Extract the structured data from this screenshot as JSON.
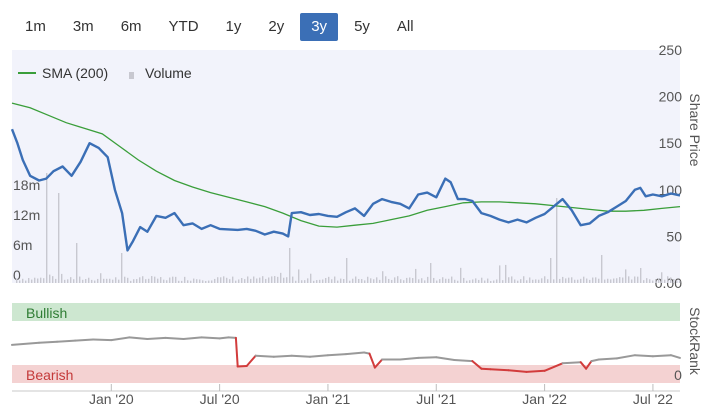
{
  "range_selector": {
    "buttons": [
      {
        "label": "1m",
        "active": false
      },
      {
        "label": "3m",
        "active": false
      },
      {
        "label": "6m",
        "active": false
      },
      {
        "label": "YTD",
        "active": false
      },
      {
        "label": "1y",
        "active": false
      },
      {
        "label": "2y",
        "active": false
      },
      {
        "label": "3y",
        "active": true
      },
      {
        "label": "5y",
        "active": false
      },
      {
        "label": "All",
        "active": false
      }
    ]
  },
  "legend": {
    "sma_label": "SMA (200)",
    "volume_label": "Volume"
  },
  "colors": {
    "price_line": "#3b6fb6",
    "sma_line": "#3a9e3a",
    "volume_bars": "#c8c8d0",
    "stockrank_line": "#999999",
    "stockrank_bearish": "#d23c3c",
    "bullish_band": "#cde7d0",
    "bearish_band": "#f4d2d2",
    "plot_bg": "#f2f3fb",
    "active_button": "#3b6fb6"
  },
  "chart_data": [
    {
      "type": "line",
      "ylabel": "Share Price",
      "ylim": [
        0,
        250
      ],
      "y_ticks": [
        "0.00",
        "50",
        "100",
        "150",
        "200",
        "250"
      ],
      "volume_ticks": [
        "0",
        "6m",
        "12m",
        "18m"
      ],
      "volume_ylim": [
        0,
        24
      ],
      "x_ticks": [
        "Jan '20",
        "Jul '20",
        "Jan '21",
        "Jul '21",
        "Jan '22",
        "Jul '22"
      ],
      "x_tick_pos": [
        4,
        10,
        16,
        22,
        28,
        34
      ],
      "xlim": [
        -1.5,
        35.5
      ],
      "series": [
        {
          "name": "Price",
          "points": [
            [
              -1.5,
              165
            ],
            [
              -1.2,
              150
            ],
            [
              -0.9,
              132
            ],
            [
              -0.5,
              115
            ],
            [
              0.0,
              110
            ],
            [
              0.4,
              112
            ],
            [
              0.8,
              120
            ],
            [
              1.3,
              125
            ],
            [
              1.8,
              115
            ],
            [
              2.3,
              130
            ],
            [
              2.8,
              150
            ],
            [
              3.3,
              145
            ],
            [
              3.8,
              135
            ],
            [
              4.2,
              100
            ],
            [
              4.6,
              75
            ],
            [
              4.9,
              35
            ],
            [
              5.2,
              45
            ],
            [
              5.6,
              60
            ],
            [
              6.0,
              55
            ],
            [
              6.5,
              72
            ],
            [
              7.0,
              70
            ],
            [
              7.5,
              75
            ],
            [
              8.0,
              62
            ],
            [
              8.5,
              64
            ],
            [
              9.0,
              58
            ],
            [
              9.5,
              62
            ],
            [
              10.0,
              58
            ],
            [
              11.0,
              57
            ],
            [
              11.5,
              58
            ],
            [
              12.0,
              56
            ],
            [
              12.5,
              52
            ],
            [
              13.0,
              55
            ],
            [
              13.5,
              53
            ],
            [
              13.8,
              50
            ],
            [
              14.0,
              75
            ],
            [
              14.5,
              76
            ],
            [
              15.0,
              73
            ],
            [
              15.5,
              74
            ],
            [
              16.0,
              72
            ],
            [
              16.5,
              71
            ],
            [
              17.0,
              76
            ],
            [
              17.5,
              80
            ],
            [
              18.0,
              72
            ],
            [
              18.5,
              85
            ],
            [
              19.0,
              90
            ],
            [
              19.5,
              87
            ],
            [
              20.0,
              85
            ],
            [
              20.5,
              80
            ],
            [
              21.0,
              95
            ],
            [
              21.5,
              97
            ],
            [
              22.0,
              92
            ],
            [
              22.5,
              112
            ],
            [
              22.8,
              108
            ],
            [
              23.2,
              90
            ],
            [
              23.6,
              90
            ],
            [
              24.0,
              88
            ],
            [
              24.5,
              75
            ],
            [
              25.0,
              72
            ],
            [
              25.5,
              68
            ],
            [
              26.0,
              65
            ],
            [
              26.5,
              68
            ],
            [
              27.0,
              65
            ],
            [
              27.5,
              70
            ],
            [
              28.0,
              74
            ],
            [
              28.5,
              82
            ],
            [
              29.0,
              90
            ],
            [
              29.5,
              78
            ],
            [
              30.0,
              62
            ],
            [
              30.5,
              64
            ],
            [
              31.0,
              72
            ],
            [
              31.5,
              76
            ],
            [
              32.0,
              82
            ],
            [
              32.5,
              88
            ],
            [
              33.0,
              100
            ],
            [
              33.3,
              102
            ],
            [
              33.6,
              93
            ],
            [
              34.0,
              95
            ],
            [
              34.5,
              93
            ],
            [
              35.0,
              96
            ],
            [
              35.5,
              94
            ]
          ]
        },
        {
          "name": "SMA (200)",
          "points": [
            [
              -1.5,
              193
            ],
            [
              -0.5,
              188
            ],
            [
              0.5,
              180
            ],
            [
              1.5,
              172
            ],
            [
              2.5,
              166
            ],
            [
              3.5,
              160
            ],
            [
              4.5,
              146
            ],
            [
              5.5,
              132
            ],
            [
              6.5,
              120
            ],
            [
              7.5,
              110
            ],
            [
              8.5,
              103
            ],
            [
              9.5,
              97
            ],
            [
              10.5,
              92
            ],
            [
              11.5,
              87
            ],
            [
              12.5,
              82
            ],
            [
              13.5,
              75
            ],
            [
              14.5,
              67
            ],
            [
              15.5,
              61
            ],
            [
              16.5,
              60
            ],
            [
              17.5,
              62
            ],
            [
              18.5,
              64
            ],
            [
              19.5,
              68
            ],
            [
              20.5,
              72
            ],
            [
              21.5,
              78
            ],
            [
              22.5,
              82
            ],
            [
              23.5,
              86
            ],
            [
              24.5,
              87
            ],
            [
              25.5,
              87
            ],
            [
              26.5,
              86
            ],
            [
              27.5,
              85
            ],
            [
              28.5,
              83
            ],
            [
              29.5,
              81
            ],
            [
              30.5,
              79
            ],
            [
              31.5,
              77
            ],
            [
              32.5,
              77
            ],
            [
              33.5,
              78
            ],
            [
              34.5,
              80
            ],
            [
              35.5,
              82
            ]
          ]
        }
      ]
    },
    {
      "type": "line",
      "ylabel": "StockRank",
      "bands": {
        "top_label": "Bullish",
        "bottom_label": "Bearish",
        "bottom_value": "0"
      },
      "ylim": [
        0,
        100
      ],
      "series": [
        {
          "name": "StockRank",
          "points": [
            [
              -1.5,
              52
            ],
            [
              0.0,
              56
            ],
            [
              1.0,
              58
            ],
            [
              2.0,
              60
            ],
            [
              3.0,
              62
            ],
            [
              4.0,
              61
            ],
            [
              5.0,
              66
            ],
            [
              6.0,
              63
            ],
            [
              7.0,
              65
            ],
            [
              8.0,
              63
            ],
            [
              9.0,
              66
            ],
            [
              10.0,
              64
            ],
            [
              10.5,
              66
            ],
            [
              10.9,
              65
            ],
            [
              11.0,
              12
            ],
            [
              11.5,
              13
            ],
            [
              12.0,
              32
            ],
            [
              13.0,
              30
            ],
            [
              14.0,
              32
            ],
            [
              15.0,
              30
            ],
            [
              16.0,
              33
            ],
            [
              17.0,
              35
            ],
            [
              18.0,
              38
            ],
            [
              18.3,
              36
            ],
            [
              18.6,
              10
            ],
            [
              19.0,
              25
            ],
            [
              20.0,
              25
            ],
            [
              21.0,
              28
            ],
            [
              22.0,
              29
            ],
            [
              23.0,
              24
            ],
            [
              24.0,
              22
            ],
            [
              24.5,
              8
            ],
            [
              25.0,
              7
            ],
            [
              26.0,
              5
            ],
            [
              27.0,
              2
            ],
            [
              28.0,
              4
            ],
            [
              29.0,
              18
            ],
            [
              30.0,
              20
            ],
            [
              30.3,
              8
            ],
            [
              30.6,
              22
            ],
            [
              31.0,
              25
            ],
            [
              32.0,
              27
            ],
            [
              33.0,
              33
            ],
            [
              34.0,
              31
            ],
            [
              35.0,
              33
            ],
            [
              35.5,
              28
            ]
          ]
        }
      ]
    }
  ]
}
